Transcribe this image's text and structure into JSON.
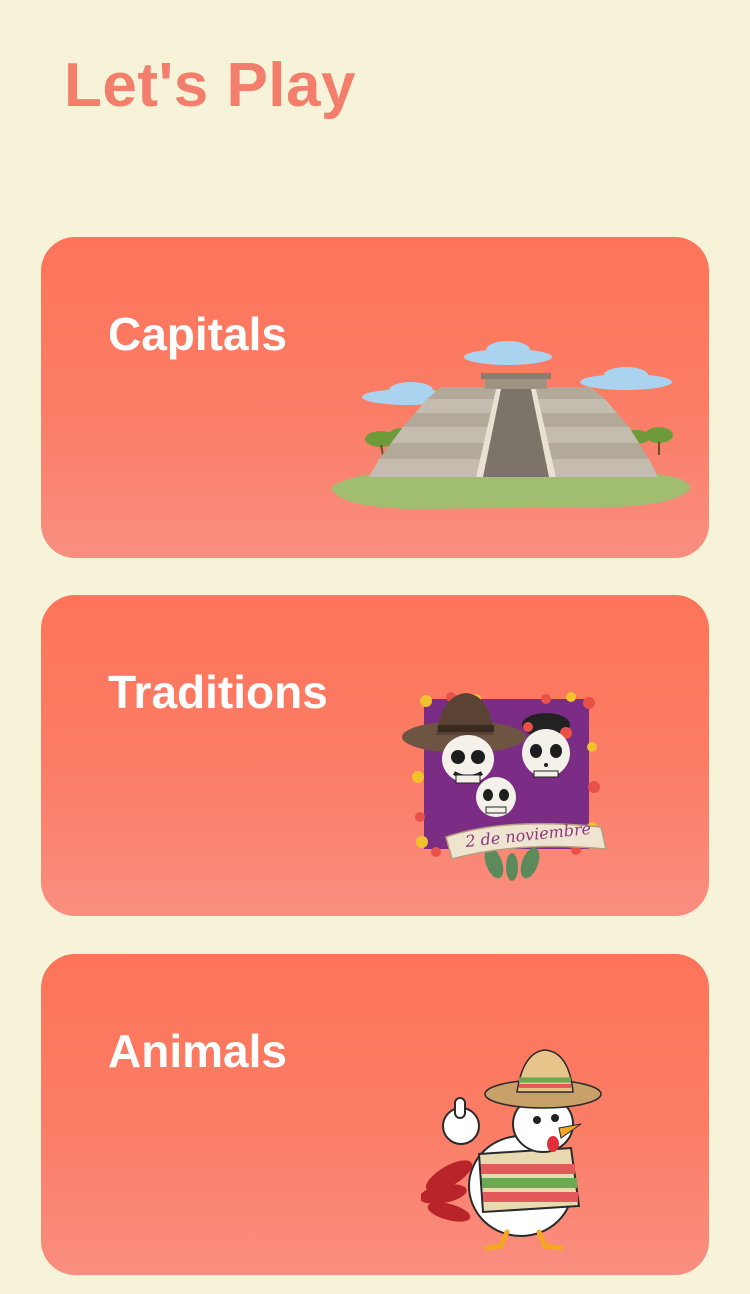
{
  "page": {
    "title": "Let's Play"
  },
  "colors": {
    "background": "#f6f3d8",
    "title": "#f47e6c",
    "card_top": "#fd7459",
    "card_bottom": "#f98e80",
    "card_text": "#ffffff"
  },
  "categories": [
    {
      "label": "Capitals",
      "illustration": "pyramid-icon"
    },
    {
      "label": "Traditions",
      "illustration": "day-of-dead-icon",
      "illustration_text": "2 de noviembre"
    },
    {
      "label": "Animals",
      "illustration": "rooster-icon"
    }
  ]
}
